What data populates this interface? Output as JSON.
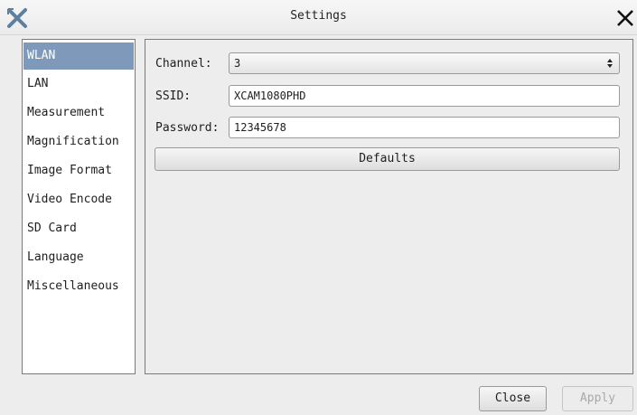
{
  "window": {
    "title": "Settings"
  },
  "sidebar": {
    "items": [
      {
        "label": "WLAN",
        "selected": true
      },
      {
        "label": "LAN",
        "selected": false
      },
      {
        "label": "Measurement",
        "selected": false
      },
      {
        "label": "Magnification",
        "selected": false
      },
      {
        "label": "Image Format",
        "selected": false
      },
      {
        "label": "Video Encode",
        "selected": false
      },
      {
        "label": "SD Card",
        "selected": false
      },
      {
        "label": "Language",
        "selected": false
      },
      {
        "label": "Miscellaneous",
        "selected": false
      }
    ]
  },
  "wlan": {
    "channel_label": "Channel:",
    "channel_value": "3",
    "ssid_label": "SSID:",
    "ssid_value": "XCAM1080PHD",
    "password_label": "Password:",
    "password_value": "12345678",
    "defaults_label": "Defaults"
  },
  "footer": {
    "close_label": "Close",
    "apply_label": "Apply"
  },
  "colors": {
    "selected_bg": "#7e99b9",
    "app_icon": "#5f7f9f"
  }
}
